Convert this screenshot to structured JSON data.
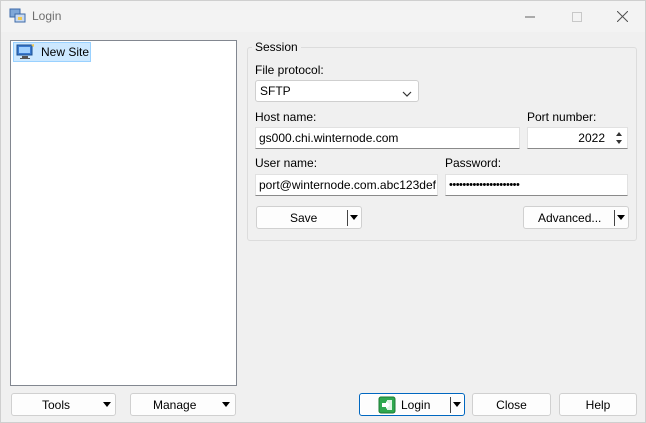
{
  "window": {
    "title": "Login",
    "icons": {
      "app": "winscp-login-icon",
      "minimize": "minimize-icon",
      "maximize": "maximize-icon",
      "close": "close-icon"
    }
  },
  "sites": {
    "items": [
      {
        "label": "New Site",
        "icon": "new-site-computer-icon"
      }
    ]
  },
  "session": {
    "group_title": "Session",
    "file_protocol_label": "File protocol:",
    "file_protocol_value": "SFTP",
    "host_name_label": "Host name:",
    "host_name_value": "gs000.chi.winternode.com",
    "port_label": "Port number:",
    "port_value": "2022",
    "user_name_label": "User name:",
    "user_name_value": "port@winternode.com.abc123def",
    "password_label": "Password:",
    "password_value": "•••••••••••••••••••••",
    "save_label": "Save",
    "advanced_label": "Advanced..."
  },
  "footer": {
    "tools_label": "Tools",
    "manage_label": "Manage",
    "login_label": "Login",
    "close_label": "Close",
    "help_label": "Help"
  },
  "colors": {
    "accent": "#0067c0",
    "selection": "#cce8ff",
    "background": "#f0f0f0"
  }
}
